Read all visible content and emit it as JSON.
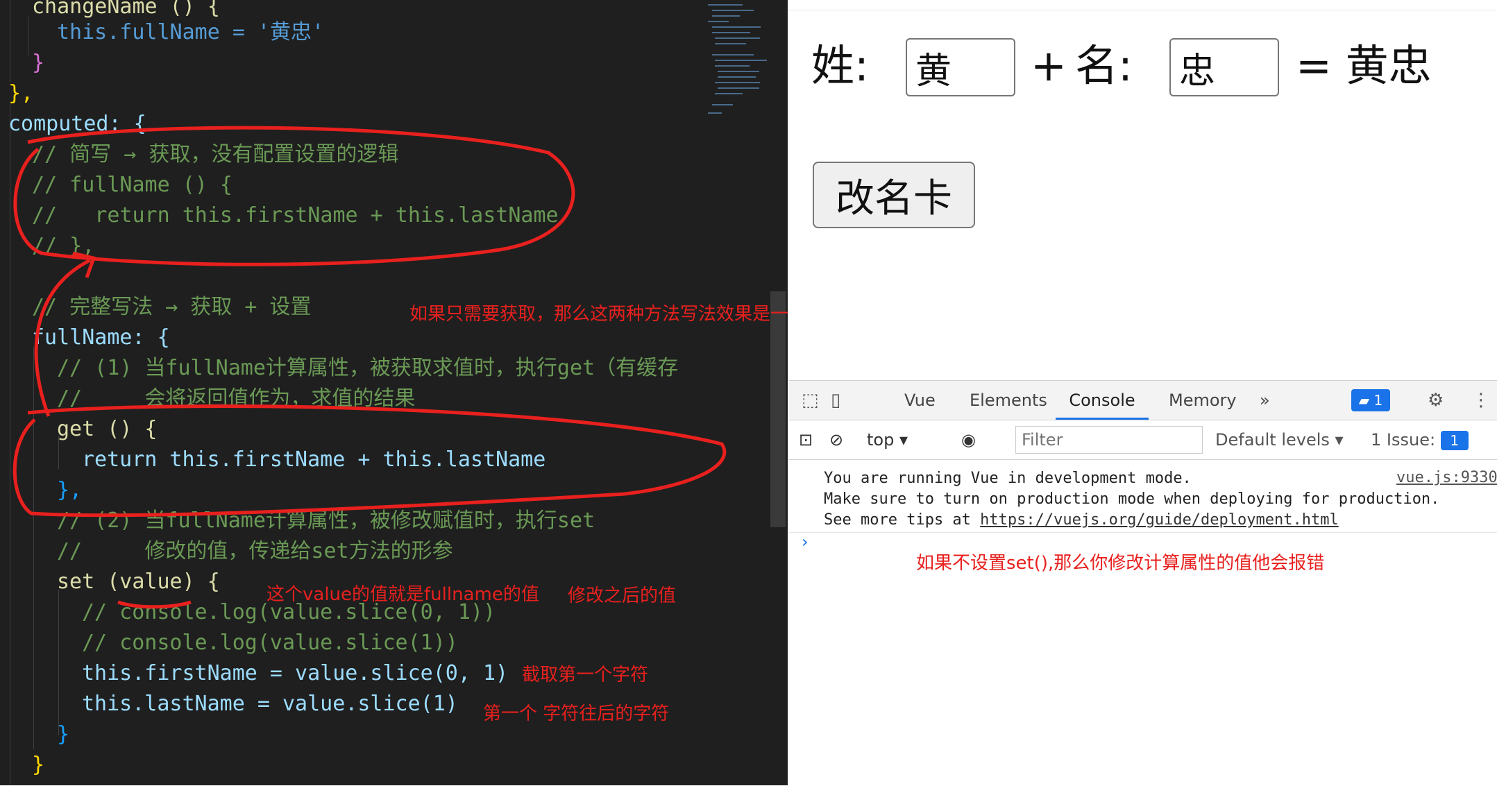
{
  "editor": {
    "lines": [
      "changeName () {",
      "this.fullName = '黄忠'",
      "}",
      "},",
      "computed: {",
      "// 简写 → 获取，没有配置设置的逻辑",
      "// fullName () {",
      "//   return this.firstName + this.lastName",
      "// },",
      "",
      "// 完整写法 → 获取 + 设置",
      "fullName: {",
      "// (1) 当fullName计算属性，被获取求值时，执行get（有缓存",
      "//     会将返回值作为，求值的结果",
      "get () {",
      "return this.firstName + this.lastName",
      "},",
      "// (2) 当fullName计算属性，被修改赋值时，执行set",
      "//     修改的值，传递给set方法的形参",
      "set (value) {",
      "// console.log(value.slice(0, 1))",
      "// console.log(value.slice(1))",
      "this.firstName = value.slice(0, 1)",
      "this.lastName = value.slice(1)",
      "}",
      "}"
    ],
    "annotations": {
      "same_effect": "如果只需要获取，那么这两种方法写法效果是一样的",
      "value_is": "这个value的值就是fullname的值",
      "after_change": "修改之后的值",
      "first_char": "截取第一个字符",
      "after_first": "第一个 字符往后的字符"
    }
  },
  "page": {
    "surname_label": "姓:",
    "surname_value": "黄",
    "plus": "+",
    "given_label": "名:",
    "given_value": "忠",
    "result": "= 黄忠",
    "rename_button": "改名卡"
  },
  "devtools": {
    "tabs": [
      "Vue",
      "Elements",
      "Console",
      "Memory"
    ],
    "active_tab": "Console",
    "more_tabs": "»",
    "messages_badge": "1",
    "context": "top",
    "filter_placeholder": "Filter",
    "levels": "Default levels",
    "issues_label": "1 Issue:",
    "issues_count": "1",
    "console": {
      "line1": "You are running Vue in development mode.",
      "line2": "Make sure to turn on production mode when deploying for production.",
      "line3_prefix": "See more tips at ",
      "line3_link": "https://vuejs.org/guide/deployment.html",
      "source": "vue.js:9330",
      "note": "如果不设置set(),那么你修改计算属性的值他会报错"
    }
  },
  "colors": {
    "annotation": "#e8201e",
    "accent": "#1a73e8",
    "editor_bg": "#1f1f1f"
  }
}
